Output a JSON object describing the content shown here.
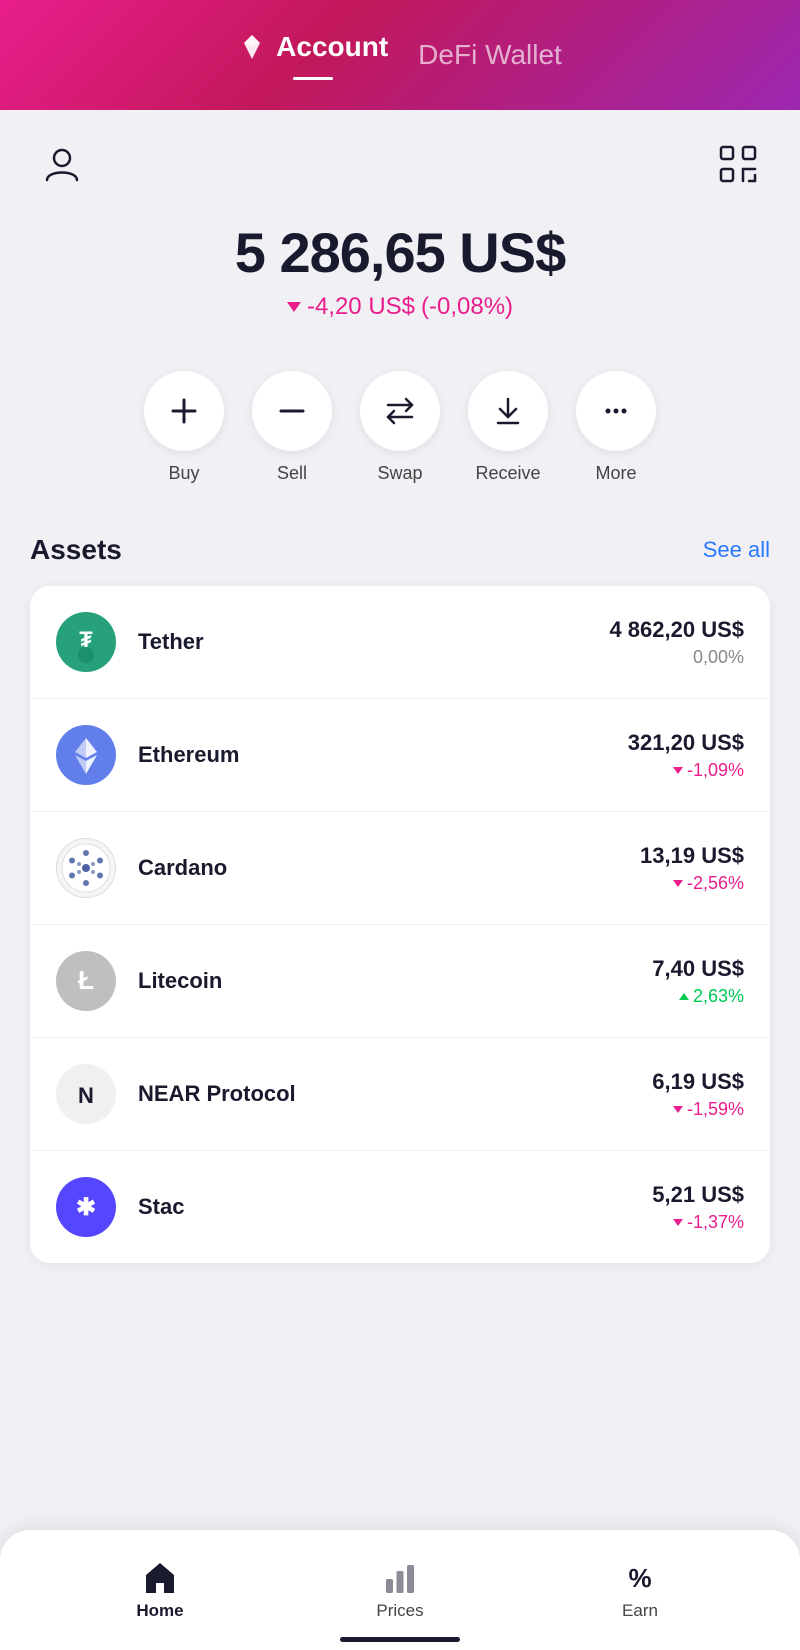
{
  "header": {
    "account_label": "Account",
    "defi_label": "DeFi Wallet",
    "active_tab": "Account"
  },
  "topbar": {
    "user_icon": "person",
    "scan_icon": "scan"
  },
  "balance": {
    "amount": "5 286,65 US$",
    "change_amount": "-4,20 US$",
    "change_percent": "(-0,08%)"
  },
  "actions": [
    {
      "id": "buy",
      "label": "Buy",
      "icon": "+"
    },
    {
      "id": "sell",
      "label": "Sell",
      "icon": "−"
    },
    {
      "id": "swap",
      "label": "Swap",
      "icon": "⇄"
    },
    {
      "id": "receive",
      "label": "Receive",
      "icon": "↓"
    },
    {
      "id": "more",
      "label": "More",
      "icon": "···"
    }
  ],
  "assets": {
    "section_title": "Assets",
    "see_all_label": "See all",
    "items": [
      {
        "name": "Tether",
        "amount": "4 862,20 US$",
        "change": "0,00%",
        "change_type": "neutral",
        "logo_text": "₮"
      },
      {
        "name": "Ethereum",
        "amount": "321,20 US$",
        "change": "-1,09%",
        "change_type": "down",
        "logo_text": "⬡"
      },
      {
        "name": "Cardano",
        "amount": "13,19 US$",
        "change": "-2,56%",
        "change_type": "down",
        "logo_text": "✦"
      },
      {
        "name": "Litecoin",
        "amount": "7,40 US$",
        "change": "2,63%",
        "change_type": "up",
        "logo_text": "Ł"
      },
      {
        "name": "NEAR Protocol",
        "amount": "6,19 US$",
        "change": "-1,59%",
        "change_type": "down",
        "logo_text": "Ν"
      },
      {
        "name": "Stac",
        "amount": "5,21 US$",
        "change": "-1,37%",
        "change_type": "down",
        "logo_text": "✱"
      }
    ]
  },
  "bottom_nav": {
    "items": [
      {
        "id": "home",
        "label": "Home",
        "icon": "home",
        "active": true
      },
      {
        "id": "prices",
        "label": "Prices",
        "icon": "prices",
        "active": false
      },
      {
        "id": "earn",
        "label": "Earn",
        "icon": "earn",
        "active": false
      }
    ]
  }
}
